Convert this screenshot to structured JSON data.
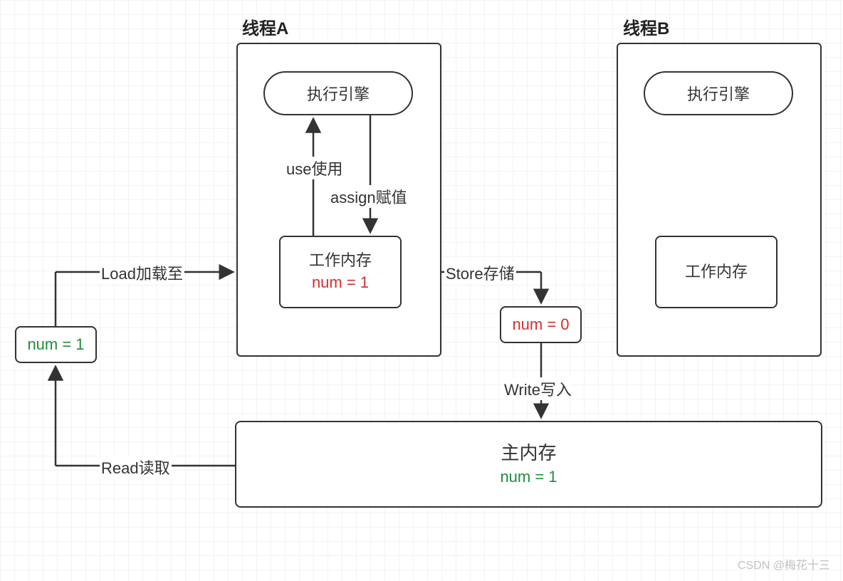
{
  "titles": {
    "threadA": "线程A",
    "threadB": "线程B"
  },
  "threadA": {
    "engine": "执行引擎",
    "working_memory": "工作内存",
    "working_value": "num = 1"
  },
  "threadB": {
    "engine": "执行引擎",
    "working_memory": "工作内存"
  },
  "main_memory": {
    "title": "主内存",
    "value": "num = 1"
  },
  "side_box": {
    "value": "num = 1"
  },
  "store_box": {
    "value": "num = 0"
  },
  "edges": {
    "load": "Load加载至",
    "use": "use使用",
    "assign": "assign赋值",
    "store": "Store存储",
    "write": "Write写入",
    "read": "Read读取"
  },
  "watermark": "CSDN @梅花十三"
}
